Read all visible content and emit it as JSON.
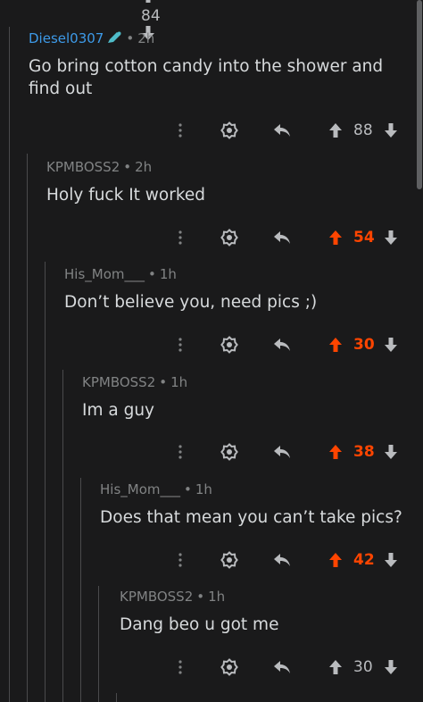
{
  "top_partial": {
    "score": "84"
  },
  "comments": [
    {
      "author": "Diesel0307",
      "is_op": true,
      "flair_icon": "pencil-icon",
      "time": "2h",
      "body": "Go bring cotton candy into the shower and find out",
      "score": "88",
      "upvoted": false
    },
    {
      "author": "KPMBOSS2",
      "is_op": false,
      "time": "2h",
      "body": "Holy fuck It worked",
      "score": "54",
      "upvoted": true
    },
    {
      "author": "His_Mom___",
      "is_op": false,
      "time": "1h",
      "body": "Don’t believe you, need pics ;)",
      "score": "30",
      "upvoted": true
    },
    {
      "author": "KPMBOSS2",
      "is_op": false,
      "time": "1h",
      "body": "Im a guy",
      "score": "38",
      "upvoted": true
    },
    {
      "author": "His_Mom___",
      "is_op": false,
      "time": "1h",
      "body": "Does that mean you can’t take pics?",
      "score": "42",
      "upvoted": true
    },
    {
      "author": "KPMBOSS2",
      "is_op": false,
      "time": "1h",
      "body": "Dang beo u got me",
      "score": "30",
      "upvoted": false
    }
  ],
  "colors": {
    "background": "#1a1a1b",
    "text": "#d7dadc",
    "meta": "#818384",
    "op_author": "#3d9ae8",
    "upvote_active": "#ff4500",
    "thread_line": "#4a4a4c",
    "icon": "#b9bbbe"
  },
  "icons": [
    "more-icon",
    "award-icon",
    "reply-icon",
    "upvote-icon",
    "downvote-icon",
    "pencil-icon"
  ]
}
